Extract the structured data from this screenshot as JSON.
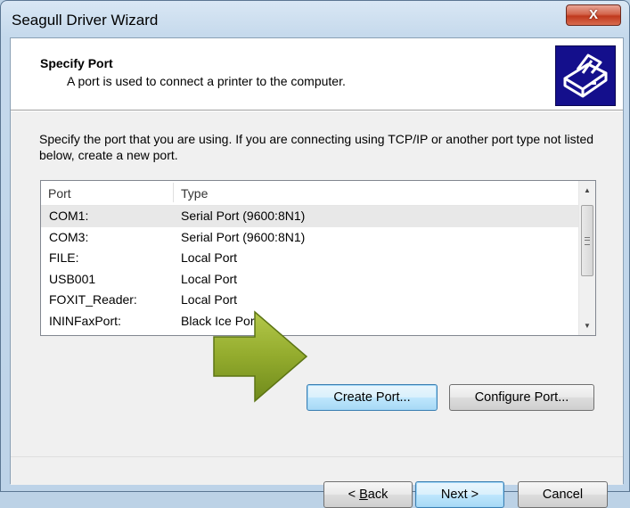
{
  "window": {
    "title": "Seagull Driver Wizard",
    "close_glyph": "X"
  },
  "header": {
    "title": "Specify Port",
    "subtitle": "A port is used to connect a printer to the computer.",
    "logo_icon": "printer-icon"
  },
  "instructions": "Specify the port that you are using.  If you are connecting using TCP/IP or another port type not listed below, create a new port.",
  "port_list": {
    "columns": [
      "Port",
      "Type"
    ],
    "rows": [
      {
        "port": "COM1:",
        "type": "Serial Port (9600:8N1)",
        "selected": true
      },
      {
        "port": "COM3:",
        "type": "Serial Port (9600:8N1)",
        "selected": false
      },
      {
        "port": "FILE:",
        "type": "Local Port",
        "selected": false
      },
      {
        "port": "USB001",
        "type": "Local Port",
        "selected": false
      },
      {
        "port": "FOXIT_Reader:",
        "type": "Local Port",
        "selected": false
      },
      {
        "port": "ININFaxPort:",
        "type": "Black Ice Port",
        "selected": false
      }
    ]
  },
  "buttons": {
    "create_port": "Create Port...",
    "configure_port": "Configure Port...",
    "back_prefix": "< ",
    "back_mnemonic": "B",
    "back_suffix": "ack",
    "next": "Next >",
    "cancel": "Cancel"
  },
  "colors": {
    "arrow_fill": "#8fa82a",
    "logo_bg": "#140f8c",
    "focus_border": "#3c7fb1"
  },
  "annotation_icon": "green-arrow-icon"
}
